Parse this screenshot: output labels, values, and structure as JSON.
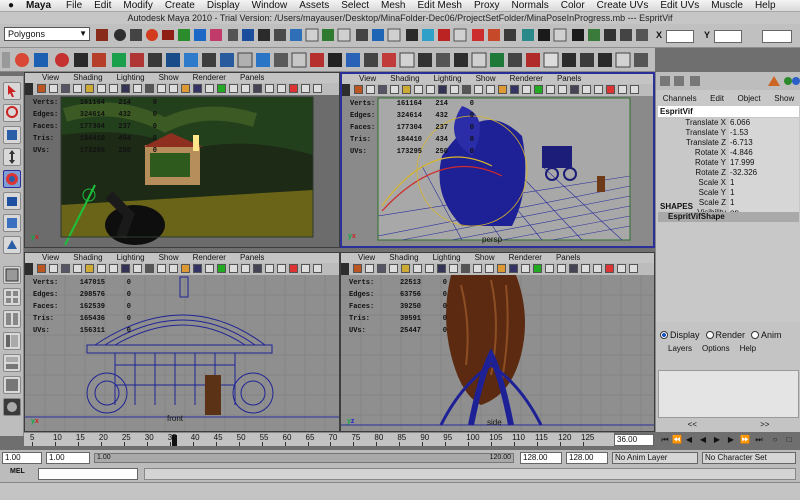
{
  "menubar": {
    "apple": "",
    "app": "Maya",
    "items": [
      "File",
      "Edit",
      "Modify",
      "Create",
      "Display",
      "Window",
      "Assets",
      "Select",
      "Mesh",
      "Edit Mesh",
      "Proxy",
      "Normals",
      "Color",
      "Create UVs",
      "Edit UVs",
      "Muscle",
      "Help"
    ]
  },
  "window_title": "Autodesk Maya 2010 - Trial Version: /Users/mayauser/Desktop/MinaFolder-Dec06/ProjectSetFolder/MinaPoseInProgress.mb   ---   EspritVif",
  "status_line": {
    "menu_set": "Polygons",
    "x_label": "X",
    "y_label": "Y"
  },
  "viewport_menu": [
    "View",
    "Shading",
    "Lighting",
    "Show",
    "Renderer",
    "Panels"
  ],
  "hud_keys": [
    "Verts:",
    "Edges:",
    "Faces:",
    "Tris:",
    "UVs:"
  ],
  "viewports": {
    "persp_tl": {
      "values": [
        [
          "161164",
          "214",
          "0"
        ],
        [
          "324614",
          "432",
          "0"
        ],
        [
          "177304",
          "237",
          "0"
        ],
        [
          "184410",
          "454",
          "0"
        ],
        [
          "173295",
          "250",
          "0"
        ]
      ],
      "camera": ""
    },
    "persp_tr": {
      "values": [
        [
          "161164",
          "214",
          "0"
        ],
        [
          "324614",
          "432",
          "0"
        ],
        [
          "177304",
          "237",
          "0"
        ],
        [
          "184410",
          "434",
          "0"
        ],
        [
          "173295",
          "250",
          "0"
        ]
      ],
      "camera": "persp"
    },
    "front": {
      "values": [
        [
          "147015",
          "0"
        ],
        [
          "298576",
          "0"
        ],
        [
          "162539",
          "0"
        ],
        [
          "165436",
          "0"
        ],
        [
          "156311",
          "0"
        ]
      ],
      "camera": "front"
    },
    "side": {
      "values": [
        [
          "22513",
          "0"
        ],
        [
          "63756",
          "0"
        ],
        [
          "39250",
          "0"
        ],
        [
          "39591",
          "0"
        ],
        [
          "25447",
          "0"
        ]
      ],
      "camera": "side"
    }
  },
  "channel_box": {
    "menu": [
      "Channels",
      "Edit",
      "Object",
      "Show"
    ],
    "object": "EspritVif",
    "attributes": [
      {
        "name": "Translate X",
        "value": "6.066"
      },
      {
        "name": "Translate Y",
        "value": "-1.53"
      },
      {
        "name": "Translate Z",
        "value": "-6.713"
      },
      {
        "name": "Rotate X",
        "value": "-4.846"
      },
      {
        "name": "Rotate Y",
        "value": "17.999"
      },
      {
        "name": "Rotate Z",
        "value": "-32.326"
      },
      {
        "name": "Scale X",
        "value": "1"
      },
      {
        "name": "Scale Y",
        "value": "1"
      },
      {
        "name": "Scale Z",
        "value": "1"
      },
      {
        "name": "Visibility",
        "value": "on"
      }
    ],
    "shapes_header": "SHAPES",
    "shape": "EspritVifShape"
  },
  "layer_editor": {
    "tabs": [
      "Display",
      "Render",
      "Anim"
    ],
    "menu": [
      "Layers",
      "Options",
      "Help"
    ],
    "nav_prev": "<<",
    "nav_next": ">>"
  },
  "time_slider": {
    "ticks": [
      "5",
      "10",
      "15",
      "20",
      "25",
      "30",
      "35",
      "40",
      "45",
      "50",
      "55",
      "60",
      "65",
      "70",
      "75",
      "80",
      "85",
      "90",
      "95",
      "100",
      "105",
      "110",
      "115",
      "120",
      "125"
    ],
    "current_frame": "36.00"
  },
  "range_slider": {
    "start": "1.00",
    "anim_start": "1.00",
    "bar_left": "1.00",
    "bar_right": "120.00",
    "anim_end": "128.00",
    "end": "128.00",
    "anim_layer": "No Anim Layer",
    "character_set": "No Character Set"
  },
  "command_line": {
    "label": "MEL"
  }
}
